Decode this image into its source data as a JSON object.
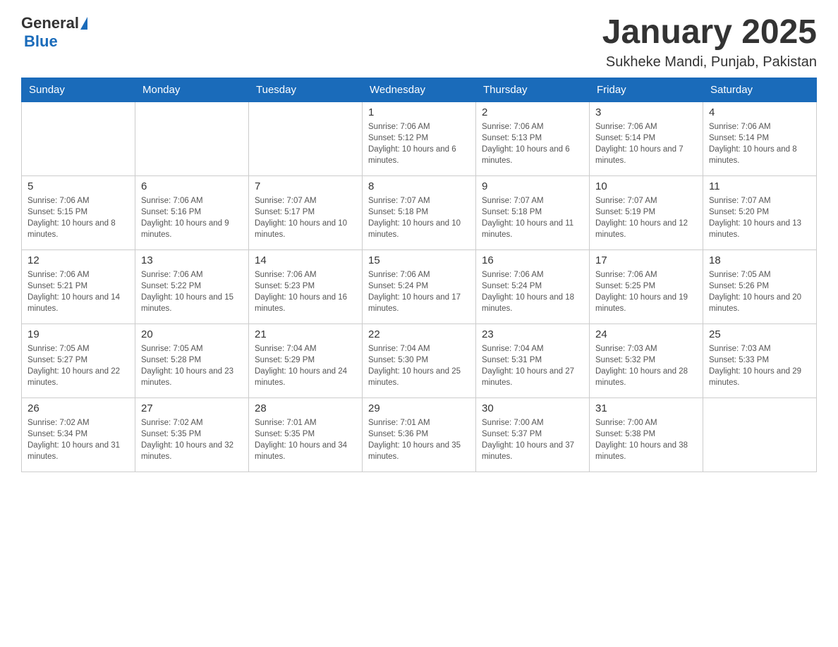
{
  "header": {
    "logo_general": "General",
    "logo_blue": "Blue",
    "month_title": "January 2025",
    "location": "Sukheke Mandi, Punjab, Pakistan"
  },
  "days_of_week": [
    "Sunday",
    "Monday",
    "Tuesday",
    "Wednesday",
    "Thursday",
    "Friday",
    "Saturday"
  ],
  "weeks": [
    [
      {
        "day": "",
        "info": ""
      },
      {
        "day": "",
        "info": ""
      },
      {
        "day": "",
        "info": ""
      },
      {
        "day": "1",
        "info": "Sunrise: 7:06 AM\nSunset: 5:12 PM\nDaylight: 10 hours and 6 minutes."
      },
      {
        "day": "2",
        "info": "Sunrise: 7:06 AM\nSunset: 5:13 PM\nDaylight: 10 hours and 6 minutes."
      },
      {
        "day": "3",
        "info": "Sunrise: 7:06 AM\nSunset: 5:14 PM\nDaylight: 10 hours and 7 minutes."
      },
      {
        "day": "4",
        "info": "Sunrise: 7:06 AM\nSunset: 5:14 PM\nDaylight: 10 hours and 8 minutes."
      }
    ],
    [
      {
        "day": "5",
        "info": "Sunrise: 7:06 AM\nSunset: 5:15 PM\nDaylight: 10 hours and 8 minutes."
      },
      {
        "day": "6",
        "info": "Sunrise: 7:06 AM\nSunset: 5:16 PM\nDaylight: 10 hours and 9 minutes."
      },
      {
        "day": "7",
        "info": "Sunrise: 7:07 AM\nSunset: 5:17 PM\nDaylight: 10 hours and 10 minutes."
      },
      {
        "day": "8",
        "info": "Sunrise: 7:07 AM\nSunset: 5:18 PM\nDaylight: 10 hours and 10 minutes."
      },
      {
        "day": "9",
        "info": "Sunrise: 7:07 AM\nSunset: 5:18 PM\nDaylight: 10 hours and 11 minutes."
      },
      {
        "day": "10",
        "info": "Sunrise: 7:07 AM\nSunset: 5:19 PM\nDaylight: 10 hours and 12 minutes."
      },
      {
        "day": "11",
        "info": "Sunrise: 7:07 AM\nSunset: 5:20 PM\nDaylight: 10 hours and 13 minutes."
      }
    ],
    [
      {
        "day": "12",
        "info": "Sunrise: 7:06 AM\nSunset: 5:21 PM\nDaylight: 10 hours and 14 minutes."
      },
      {
        "day": "13",
        "info": "Sunrise: 7:06 AM\nSunset: 5:22 PM\nDaylight: 10 hours and 15 minutes."
      },
      {
        "day": "14",
        "info": "Sunrise: 7:06 AM\nSunset: 5:23 PM\nDaylight: 10 hours and 16 minutes."
      },
      {
        "day": "15",
        "info": "Sunrise: 7:06 AM\nSunset: 5:24 PM\nDaylight: 10 hours and 17 minutes."
      },
      {
        "day": "16",
        "info": "Sunrise: 7:06 AM\nSunset: 5:24 PM\nDaylight: 10 hours and 18 minutes."
      },
      {
        "day": "17",
        "info": "Sunrise: 7:06 AM\nSunset: 5:25 PM\nDaylight: 10 hours and 19 minutes."
      },
      {
        "day": "18",
        "info": "Sunrise: 7:05 AM\nSunset: 5:26 PM\nDaylight: 10 hours and 20 minutes."
      }
    ],
    [
      {
        "day": "19",
        "info": "Sunrise: 7:05 AM\nSunset: 5:27 PM\nDaylight: 10 hours and 22 minutes."
      },
      {
        "day": "20",
        "info": "Sunrise: 7:05 AM\nSunset: 5:28 PM\nDaylight: 10 hours and 23 minutes."
      },
      {
        "day": "21",
        "info": "Sunrise: 7:04 AM\nSunset: 5:29 PM\nDaylight: 10 hours and 24 minutes."
      },
      {
        "day": "22",
        "info": "Sunrise: 7:04 AM\nSunset: 5:30 PM\nDaylight: 10 hours and 25 minutes."
      },
      {
        "day": "23",
        "info": "Sunrise: 7:04 AM\nSunset: 5:31 PM\nDaylight: 10 hours and 27 minutes."
      },
      {
        "day": "24",
        "info": "Sunrise: 7:03 AM\nSunset: 5:32 PM\nDaylight: 10 hours and 28 minutes."
      },
      {
        "day": "25",
        "info": "Sunrise: 7:03 AM\nSunset: 5:33 PM\nDaylight: 10 hours and 29 minutes."
      }
    ],
    [
      {
        "day": "26",
        "info": "Sunrise: 7:02 AM\nSunset: 5:34 PM\nDaylight: 10 hours and 31 minutes."
      },
      {
        "day": "27",
        "info": "Sunrise: 7:02 AM\nSunset: 5:35 PM\nDaylight: 10 hours and 32 minutes."
      },
      {
        "day": "28",
        "info": "Sunrise: 7:01 AM\nSunset: 5:35 PM\nDaylight: 10 hours and 34 minutes."
      },
      {
        "day": "29",
        "info": "Sunrise: 7:01 AM\nSunset: 5:36 PM\nDaylight: 10 hours and 35 minutes."
      },
      {
        "day": "30",
        "info": "Sunrise: 7:00 AM\nSunset: 5:37 PM\nDaylight: 10 hours and 37 minutes."
      },
      {
        "day": "31",
        "info": "Sunrise: 7:00 AM\nSunset: 5:38 PM\nDaylight: 10 hours and 38 minutes."
      },
      {
        "day": "",
        "info": ""
      }
    ]
  ]
}
